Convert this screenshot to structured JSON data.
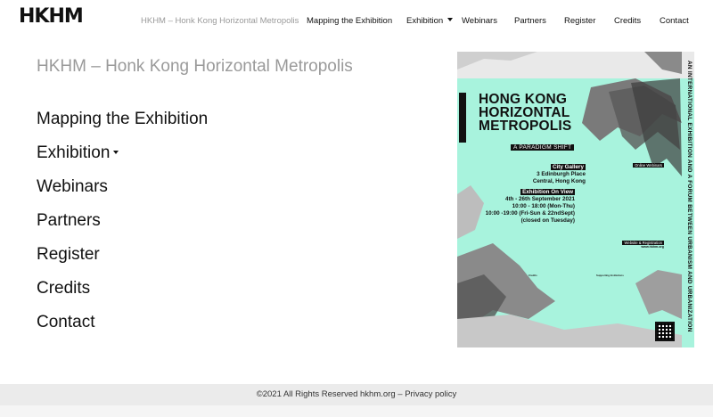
{
  "header": {
    "logo": "HKHM",
    "nav": [
      {
        "label": "HKHM – Honk Kong Horizontal Metropolis",
        "current": true
      },
      {
        "label": "Mapping the Exhibition"
      },
      {
        "label": "Exhibition",
        "has_dropdown": true,
        "dropdown_icon": "chevron-down-icon"
      },
      {
        "label": "Webinars"
      },
      {
        "label": "Partners"
      },
      {
        "label": "Register"
      },
      {
        "label": "Credits"
      },
      {
        "label": "Contact"
      }
    ]
  },
  "menu": {
    "current_page": "HKHM – Honk Kong Horizontal Metropolis",
    "items": [
      {
        "label": "Mapping the Exhibition"
      },
      {
        "label": "Exhibition",
        "has_dropdown": true
      },
      {
        "label": "Webinars"
      },
      {
        "label": "Partners"
      },
      {
        "label": "Register"
      },
      {
        "label": "Credits"
      },
      {
        "label": "Contact"
      }
    ]
  },
  "poster": {
    "title_line1": "HONG KONG",
    "title_line2": "HORIZONTAL",
    "title_line3": "METROPOLIS",
    "subtitle": "A PARADIGM SHIFT",
    "vertical_text": "AN INTERNATIONAL EXHIBITION AND A FORUM BETWEEN URBANISM AND URBANIZATION",
    "venue_label": "City Gallery",
    "venue_line1": "3 Edinburgh Place",
    "venue_line2": "Central, Hong Kong",
    "exhibition_label": "Exhibition On View",
    "dates_line1": "4th - 26th September 2021",
    "dates_line2": "10:00 - 18:00 (Mon-Thu)",
    "dates_line3": "10:00 -19:00 (Fri-Sun & 22ndSept)",
    "dates_line4": "(closed on Tuesday)",
    "webinars_label": "Online Webinars",
    "website_label": "Website & Registration",
    "website": "www.hkhm.org",
    "credits_label": "Credits",
    "support_label": "Supporting Institutions",
    "colors": {
      "background": "#a8f3dd",
      "accent": "#111111"
    }
  },
  "footer": {
    "copyright": "©2021 All Rights Reserved hkhm.org – ",
    "privacy_link": "Privacy policy"
  }
}
